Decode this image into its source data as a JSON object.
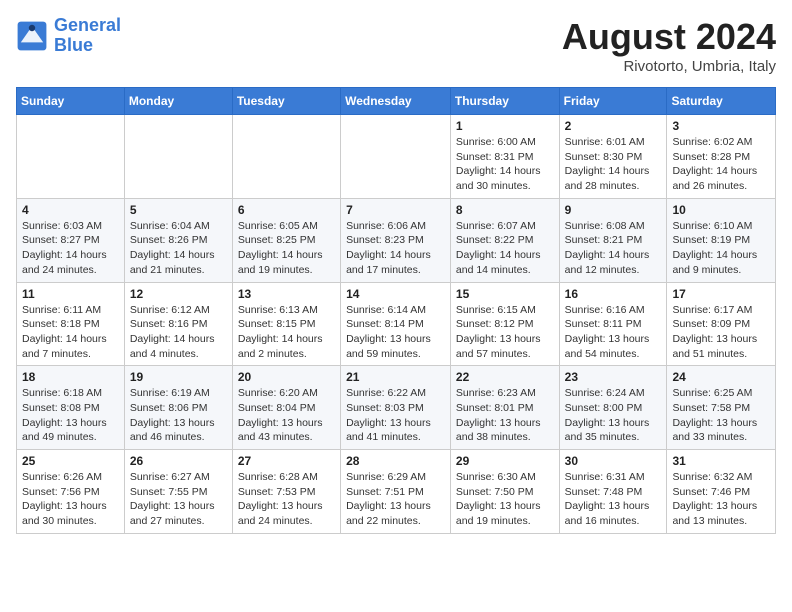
{
  "header": {
    "logo_line1": "General",
    "logo_line2": "Blue",
    "month_year": "August 2024",
    "location": "Rivotorto, Umbria, Italy"
  },
  "days_of_week": [
    "Sunday",
    "Monday",
    "Tuesday",
    "Wednesday",
    "Thursday",
    "Friday",
    "Saturday"
  ],
  "weeks": [
    [
      {
        "day": "",
        "info": ""
      },
      {
        "day": "",
        "info": ""
      },
      {
        "day": "",
        "info": ""
      },
      {
        "day": "",
        "info": ""
      },
      {
        "day": "1",
        "info": "Sunrise: 6:00 AM\nSunset: 8:31 PM\nDaylight: 14 hours\nand 30 minutes."
      },
      {
        "day": "2",
        "info": "Sunrise: 6:01 AM\nSunset: 8:30 PM\nDaylight: 14 hours\nand 28 minutes."
      },
      {
        "day": "3",
        "info": "Sunrise: 6:02 AM\nSunset: 8:28 PM\nDaylight: 14 hours\nand 26 minutes."
      }
    ],
    [
      {
        "day": "4",
        "info": "Sunrise: 6:03 AM\nSunset: 8:27 PM\nDaylight: 14 hours\nand 24 minutes."
      },
      {
        "day": "5",
        "info": "Sunrise: 6:04 AM\nSunset: 8:26 PM\nDaylight: 14 hours\nand 21 minutes."
      },
      {
        "day": "6",
        "info": "Sunrise: 6:05 AM\nSunset: 8:25 PM\nDaylight: 14 hours\nand 19 minutes."
      },
      {
        "day": "7",
        "info": "Sunrise: 6:06 AM\nSunset: 8:23 PM\nDaylight: 14 hours\nand 17 minutes."
      },
      {
        "day": "8",
        "info": "Sunrise: 6:07 AM\nSunset: 8:22 PM\nDaylight: 14 hours\nand 14 minutes."
      },
      {
        "day": "9",
        "info": "Sunrise: 6:08 AM\nSunset: 8:21 PM\nDaylight: 14 hours\nand 12 minutes."
      },
      {
        "day": "10",
        "info": "Sunrise: 6:10 AM\nSunset: 8:19 PM\nDaylight: 14 hours\nand 9 minutes."
      }
    ],
    [
      {
        "day": "11",
        "info": "Sunrise: 6:11 AM\nSunset: 8:18 PM\nDaylight: 14 hours\nand 7 minutes."
      },
      {
        "day": "12",
        "info": "Sunrise: 6:12 AM\nSunset: 8:16 PM\nDaylight: 14 hours\nand 4 minutes."
      },
      {
        "day": "13",
        "info": "Sunrise: 6:13 AM\nSunset: 8:15 PM\nDaylight: 14 hours\nand 2 minutes."
      },
      {
        "day": "14",
        "info": "Sunrise: 6:14 AM\nSunset: 8:14 PM\nDaylight: 13 hours\nand 59 minutes."
      },
      {
        "day": "15",
        "info": "Sunrise: 6:15 AM\nSunset: 8:12 PM\nDaylight: 13 hours\nand 57 minutes."
      },
      {
        "day": "16",
        "info": "Sunrise: 6:16 AM\nSunset: 8:11 PM\nDaylight: 13 hours\nand 54 minutes."
      },
      {
        "day": "17",
        "info": "Sunrise: 6:17 AM\nSunset: 8:09 PM\nDaylight: 13 hours\nand 51 minutes."
      }
    ],
    [
      {
        "day": "18",
        "info": "Sunrise: 6:18 AM\nSunset: 8:08 PM\nDaylight: 13 hours\nand 49 minutes."
      },
      {
        "day": "19",
        "info": "Sunrise: 6:19 AM\nSunset: 8:06 PM\nDaylight: 13 hours\nand 46 minutes."
      },
      {
        "day": "20",
        "info": "Sunrise: 6:20 AM\nSunset: 8:04 PM\nDaylight: 13 hours\nand 43 minutes."
      },
      {
        "day": "21",
        "info": "Sunrise: 6:22 AM\nSunset: 8:03 PM\nDaylight: 13 hours\nand 41 minutes."
      },
      {
        "day": "22",
        "info": "Sunrise: 6:23 AM\nSunset: 8:01 PM\nDaylight: 13 hours\nand 38 minutes."
      },
      {
        "day": "23",
        "info": "Sunrise: 6:24 AM\nSunset: 8:00 PM\nDaylight: 13 hours\nand 35 minutes."
      },
      {
        "day": "24",
        "info": "Sunrise: 6:25 AM\nSunset: 7:58 PM\nDaylight: 13 hours\nand 33 minutes."
      }
    ],
    [
      {
        "day": "25",
        "info": "Sunrise: 6:26 AM\nSunset: 7:56 PM\nDaylight: 13 hours\nand 30 minutes."
      },
      {
        "day": "26",
        "info": "Sunrise: 6:27 AM\nSunset: 7:55 PM\nDaylight: 13 hours\nand 27 minutes."
      },
      {
        "day": "27",
        "info": "Sunrise: 6:28 AM\nSunset: 7:53 PM\nDaylight: 13 hours\nand 24 minutes."
      },
      {
        "day": "28",
        "info": "Sunrise: 6:29 AM\nSunset: 7:51 PM\nDaylight: 13 hours\nand 22 minutes."
      },
      {
        "day": "29",
        "info": "Sunrise: 6:30 AM\nSunset: 7:50 PM\nDaylight: 13 hours\nand 19 minutes."
      },
      {
        "day": "30",
        "info": "Sunrise: 6:31 AM\nSunset: 7:48 PM\nDaylight: 13 hours\nand 16 minutes."
      },
      {
        "day": "31",
        "info": "Sunrise: 6:32 AM\nSunset: 7:46 PM\nDaylight: 13 hours\nand 13 minutes."
      }
    ]
  ]
}
